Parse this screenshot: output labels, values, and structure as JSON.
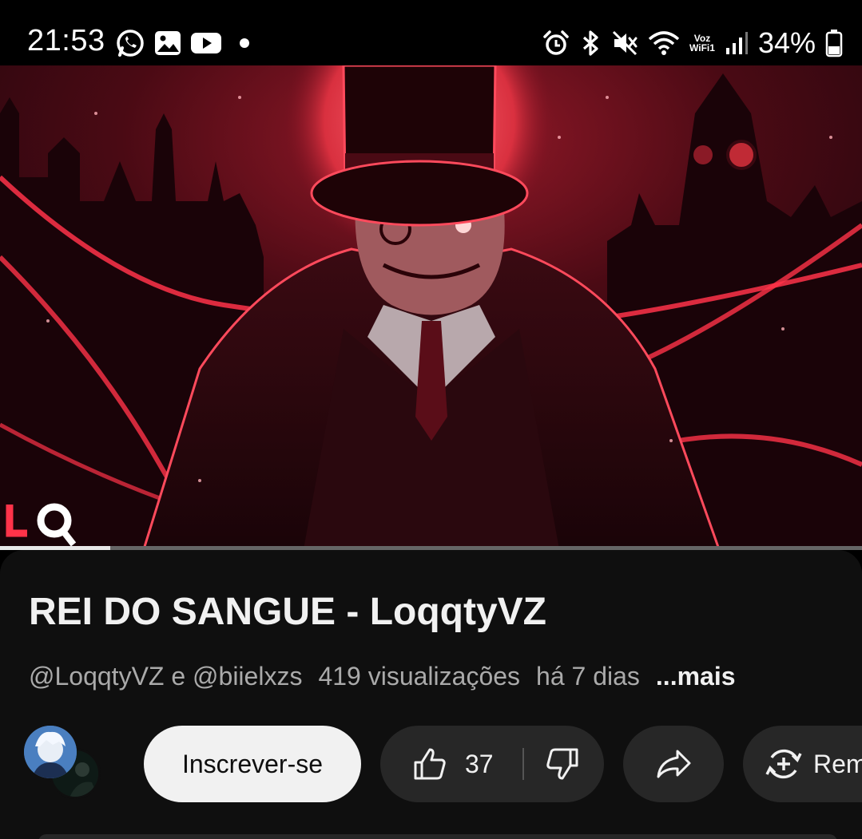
{
  "status_bar": {
    "time": "21:53",
    "left_icons": [
      "whatsapp-icon",
      "gallery-icon",
      "youtube-icon",
      "dot-icon"
    ],
    "right_icons": [
      "alarm-icon",
      "bluetooth-icon",
      "mute-icon",
      "wifi-icon",
      "vowifi-icon",
      "signal-icon",
      "battery-icon"
    ],
    "vowifi_top": "Voz",
    "vowifi_bottom": "WiFi1",
    "battery": "34%"
  },
  "video": {
    "thumbnail": "dark-red-gentleman-top-hat",
    "watermark": "LQ",
    "progress": 0.128
  },
  "info": {
    "title": "REI DO SANGUE - LoqqtyVZ",
    "channels": "@LoqqtyVZ e @biielxzs",
    "views": "419 visualizações",
    "age": "há 7 dias",
    "more": "...mais"
  },
  "actions": {
    "subscribe": "Inscrever-se",
    "like_count": "37",
    "remix": "Remix"
  },
  "colors": {
    "background": "#0f0f0f",
    "pill": "#272727",
    "subscribe_bg": "#f1f1f1",
    "accent_red": "#e0203a"
  }
}
